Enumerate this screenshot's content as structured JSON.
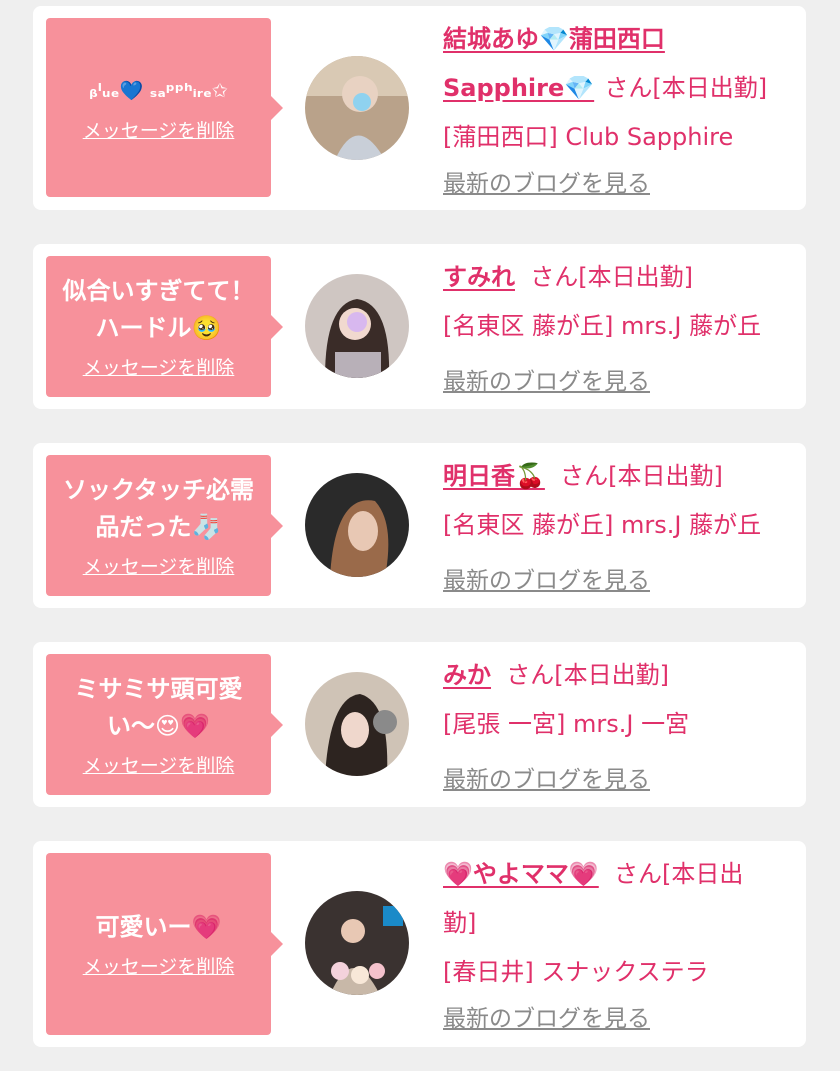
{
  "colors": {
    "bubble": "#f7919b",
    "accent": "#e0306a",
    "muted": "#8a8a8a",
    "bg": "#efefef"
  },
  "common": {
    "delete_label": "メッセージを削除",
    "blog_label": "最新のブログを見る",
    "san_suffix": "さん[本日出勤]"
  },
  "cards": [
    {
      "message": "ᵦˡᵤₑ💙 ₛₐᵖᵖʰᵢᵣₑ✩",
      "name_line1": "結城あゆ💎蒲田西口",
      "name_line2": "Sapphire💎",
      "san": "さん[本日出勤]",
      "shop": "[蒲田西口] Club Sapphire"
    },
    {
      "message_line1": "似合いすぎてて！",
      "message_line2": "ハードル🥹",
      "name": "すみれ",
      "san": "さん[本日出勤]",
      "shop": "[名東区 藤が丘] mrs.J 藤が丘"
    },
    {
      "message_line1": "ソックタッチ必需",
      "message_line2": "品だった🧦",
      "name": "明日香🍒",
      "san": "さん[本日出勤]",
      "shop": "[名東区 藤が丘] mrs.J 藤が丘"
    },
    {
      "message_line1": "ミサミサ頭可愛",
      "message_line2": "い〜😍💗",
      "name": "みか",
      "san": "さん[本日出勤]",
      "shop": "[尾張 一宮] mrs.J 一宮"
    },
    {
      "message": "可愛いー💗",
      "name": "💗やよママ💗",
      "san": "さん[本日出",
      "san2": "勤]",
      "shop": "[春日井] スナックステラ"
    }
  ]
}
